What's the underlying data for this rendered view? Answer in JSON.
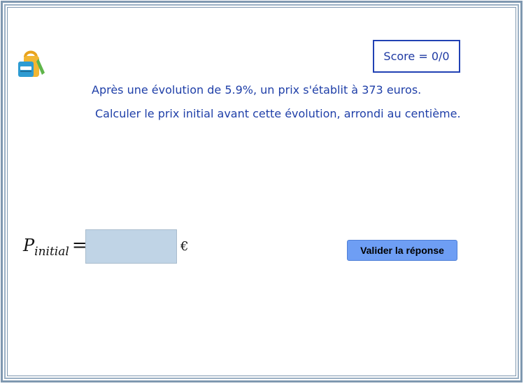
{
  "score": {
    "text": "Score = 0/0"
  },
  "question": {
    "line1": "Après une évolution de 5.9%, un prix s'établit à 373 euros.",
    "line2": "Calculer le prix initial avant cette évolution, arrondi au centième."
  },
  "formula": {
    "variable": "P",
    "subscript": "initial",
    "equals": "="
  },
  "answer": {
    "value": "",
    "unit": "€"
  },
  "actions": {
    "validate_label": "Valider la réponse"
  },
  "icons": {
    "logo": "backpack-icon"
  },
  "colors": {
    "frame": "#7f98b0",
    "text_blue": "#1f3fa8",
    "input_bg": "#c0d4e6",
    "button_bg": "#6e9ef4"
  }
}
